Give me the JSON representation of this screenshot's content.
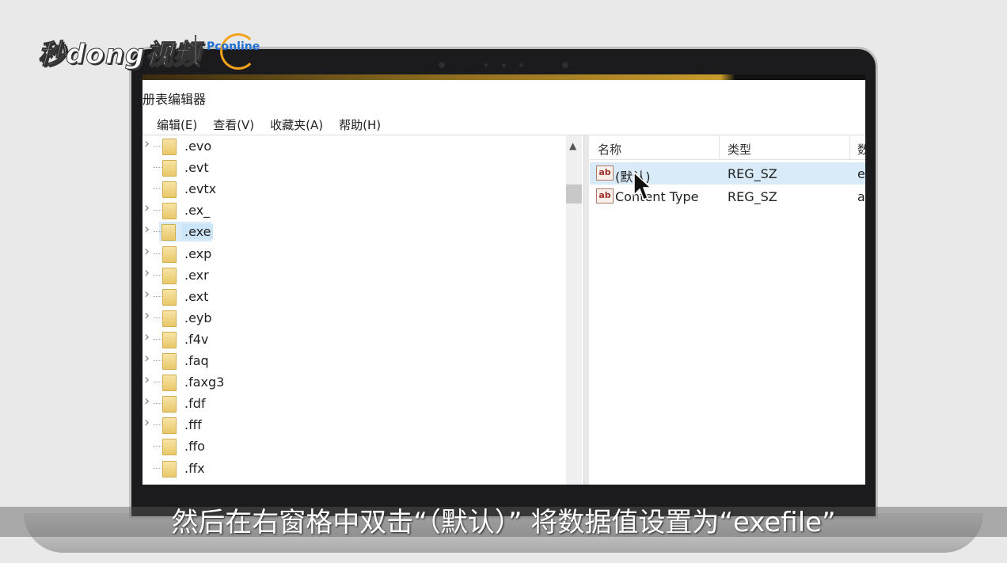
{
  "logo": {
    "main": "秒dong视频",
    "sub": "Pconline"
  },
  "window": {
    "title": "册表编辑器"
  },
  "menu": [
    "编辑(E)",
    "查看(V)",
    "收藏夹(A)",
    "帮助(H)"
  ],
  "tree": {
    "items": [
      {
        "label": ".evo",
        "expandable": true
      },
      {
        "label": ".evt",
        "expandable": false
      },
      {
        "label": ".evtx",
        "expandable": false
      },
      {
        "label": ".ex_",
        "expandable": true
      },
      {
        "label": ".exe",
        "expandable": true,
        "selected": true
      },
      {
        "label": ".exp",
        "expandable": true
      },
      {
        "label": ".exr",
        "expandable": true
      },
      {
        "label": ".ext",
        "expandable": true
      },
      {
        "label": ".eyb",
        "expandable": true
      },
      {
        "label": ".f4v",
        "expandable": true
      },
      {
        "label": ".faq",
        "expandable": true
      },
      {
        "label": ".faxg3",
        "expandable": true
      },
      {
        "label": ".fdf",
        "expandable": true
      },
      {
        "label": ".fff",
        "expandable": true
      },
      {
        "label": ".ffo",
        "expandable": false
      },
      {
        "label": ".ffx",
        "expandable": false
      }
    ]
  },
  "values": {
    "headers": {
      "name": "名称",
      "type": "类型",
      "data": "数"
    },
    "rows": [
      {
        "name": "(默认)",
        "type": "REG_SZ",
        "data": "e",
        "highlighted": true
      },
      {
        "name": "Content Type",
        "type": "REG_SZ",
        "data": "a",
        "highlighted": false
      }
    ]
  },
  "icons": {
    "value": "ab-string-icon",
    "folder": "folder-icon"
  },
  "subtitle": "然后在右窗格中双击“（默认）” 将数据值设置为“exefile”"
}
